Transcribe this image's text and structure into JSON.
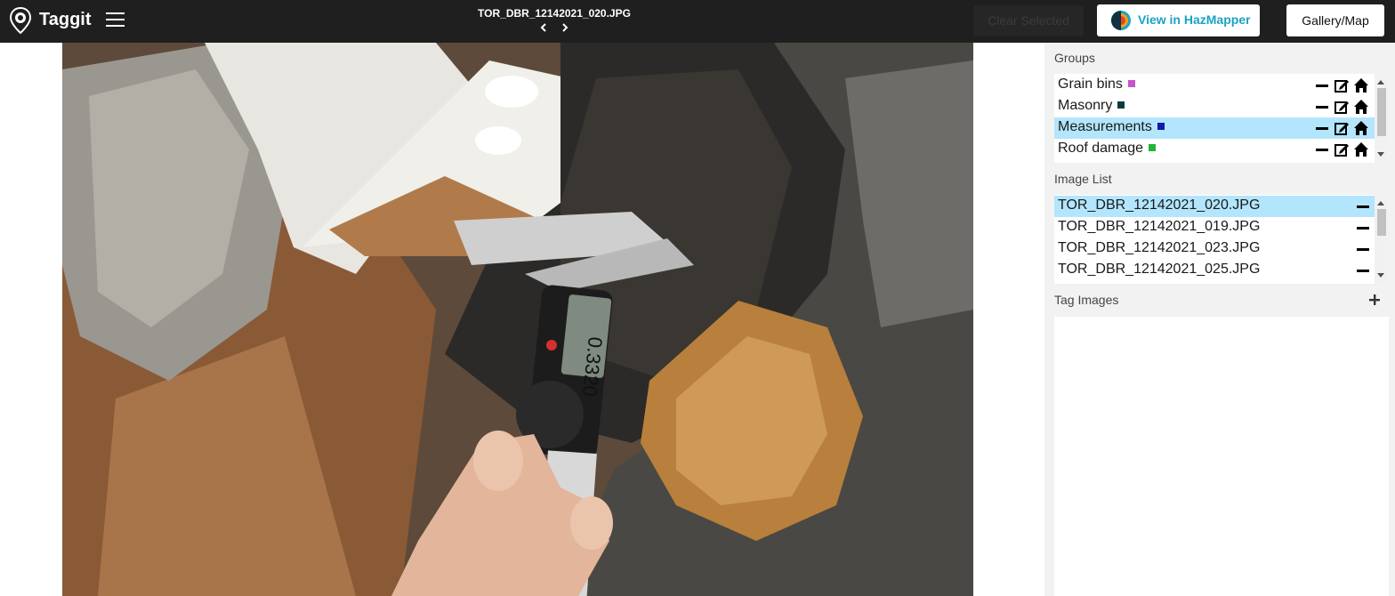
{
  "app": {
    "title": "Taggit"
  },
  "header": {
    "file_title": "TOR_DBR_12142021_020.JPG",
    "clear_selected_label": "Clear Selected",
    "hazmapper_label": "View in HazMapper",
    "gallery_label": "Gallery/Map",
    "icons": [
      "taggit-logo-icon",
      "menu-icon",
      "chevron-left-icon",
      "chevron-right-icon",
      "hazmapper-logo-icon"
    ]
  },
  "photo": {
    "caliper_reading": "0.3320"
  },
  "panel": {
    "groups_label": "Groups",
    "groups": [
      {
        "name": "Grain bins",
        "color": "#c455c8",
        "selected": false
      },
      {
        "name": "Masonry",
        "color": "#0d3b3b",
        "selected": false
      },
      {
        "name": "Measurements",
        "color": "#1717a8",
        "selected": true
      },
      {
        "name": "Roof damage",
        "color": "#22b33a",
        "selected": false
      }
    ],
    "group_actions": [
      "minus-icon",
      "edit-icon",
      "home-icon"
    ],
    "image_list_label": "Image List",
    "images": [
      {
        "name": "TOR_DBR_12142021_020.JPG",
        "selected": true
      },
      {
        "name": "TOR_DBR_12142021_019.JPG",
        "selected": false
      },
      {
        "name": "TOR_DBR_12142021_023.JPG",
        "selected": false
      },
      {
        "name": "TOR_DBR_12142021_025.JPG",
        "selected": false
      }
    ],
    "tag_images_label": "Tag Images"
  }
}
